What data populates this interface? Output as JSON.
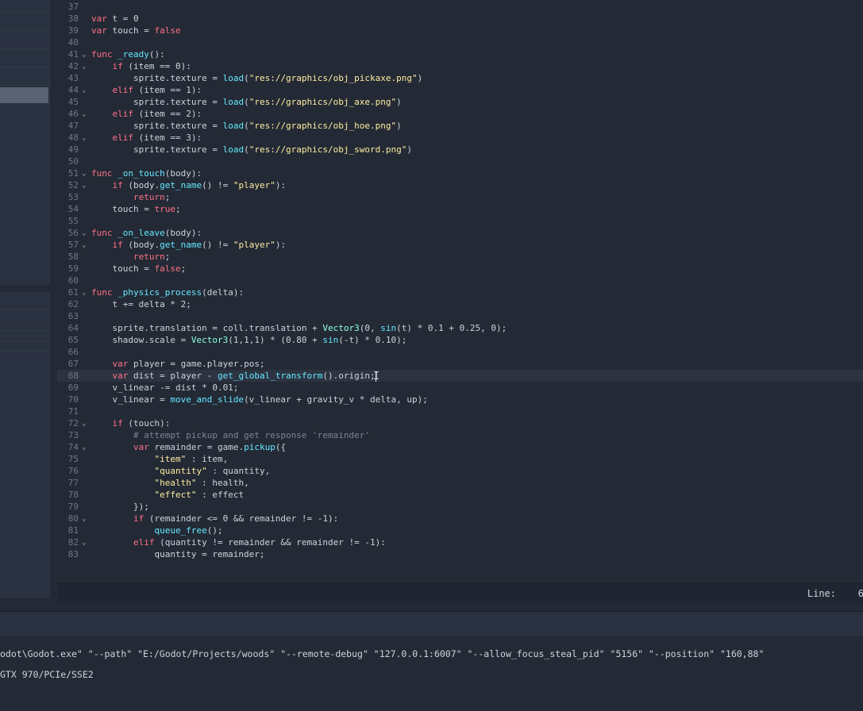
{
  "editor": {
    "lines": [
      {
        "n": "37",
        "fold": "",
        "html": ""
      },
      {
        "n": "38",
        "fold": "",
        "html": "<span class='kw'>var</span> t = 0"
      },
      {
        "n": "39",
        "fold": "",
        "html": "<span class='kw'>var</span> touch = <span class='kw'>false</span>"
      },
      {
        "n": "40",
        "fold": "",
        "html": ""
      },
      {
        "n": "41",
        "fold": "v",
        "html": "<span class='kw'>func</span> <span class='fn'>_ready</span>():"
      },
      {
        "n": "42",
        "fold": "v",
        "html": "    <span class='kw'>if</span> (item == 0):"
      },
      {
        "n": "43",
        "fold": "",
        "html": "        sprite.texture = <span class='fn'>load</span>(<span class='str'>\"res://graphics/obj_pickaxe.png\"</span>)"
      },
      {
        "n": "44",
        "fold": "v",
        "html": "    <span class='kw'>elif</span> (item == 1):"
      },
      {
        "n": "45",
        "fold": "",
        "html": "        sprite.texture = <span class='fn'>load</span>(<span class='str'>\"res://graphics/obj_axe.png\"</span>)"
      },
      {
        "n": "46",
        "fold": "v",
        "html": "    <span class='kw'>elif</span> (item == 2):"
      },
      {
        "n": "47",
        "fold": "",
        "html": "        sprite.texture = <span class='fn'>load</span>(<span class='str'>\"res://graphics/obj_hoe.png\"</span>)"
      },
      {
        "n": "48",
        "fold": "v",
        "html": "    <span class='kw'>elif</span> (item == 3):"
      },
      {
        "n": "49",
        "fold": "",
        "html": "        sprite.texture = <span class='fn'>load</span>(<span class='str'>\"res://graphics/obj_sword.png\"</span>)"
      },
      {
        "n": "50",
        "fold": "",
        "html": ""
      },
      {
        "n": "51",
        "fold": "v",
        "html": "<span class='kw'>func</span> <span class='fn'>_on_touch</span>(body):"
      },
      {
        "n": "52",
        "fold": "v",
        "html": "    <span class='kw'>if</span> (body.<span class='fn'>get_name</span>() != <span class='str'>\"player\"</span>):"
      },
      {
        "n": "53",
        "fold": "",
        "html": "        <span class='kw'>return</span>;"
      },
      {
        "n": "54",
        "fold": "",
        "html": "    touch = <span class='kw'>true</span>;"
      },
      {
        "n": "55",
        "fold": "",
        "html": ""
      },
      {
        "n": "56",
        "fold": "v",
        "html": "<span class='kw'>func</span> <span class='fn'>_on_leave</span>(body):"
      },
      {
        "n": "57",
        "fold": "v",
        "html": "    <span class='kw'>if</span> (body.<span class='fn'>get_name</span>() != <span class='str'>\"player\"</span>):"
      },
      {
        "n": "58",
        "fold": "",
        "html": "        <span class='kw'>return</span>;"
      },
      {
        "n": "59",
        "fold": "",
        "html": "    touch = <span class='kw'>false</span>;"
      },
      {
        "n": "60",
        "fold": "",
        "html": ""
      },
      {
        "n": "61",
        "fold": "v",
        "html": "<span class='kw'>func</span> <span class='fn'>_physics_process</span>(delta):"
      },
      {
        "n": "62",
        "fold": "",
        "html": "    t += delta * 2;"
      },
      {
        "n": "63",
        "fold": "",
        "html": ""
      },
      {
        "n": "64",
        "fold": "",
        "html": "    sprite.translation = coll.translation + <span class='bi'>Vector3</span>(0, <span class='fn'>sin</span>(t) * 0.1 + 0.25, 0);"
      },
      {
        "n": "65",
        "fold": "",
        "html": "    shadow.scale = <span class='bi'>Vector3</span>(1,1,1) * (0.80 + <span class='fn'>sin</span>(-t) * 0.10);"
      },
      {
        "n": "66",
        "fold": "",
        "html": ""
      },
      {
        "n": "67",
        "fold": "",
        "html": "    <span class='kw'>var</span> player = game.player.pos;"
      },
      {
        "n": "68",
        "fold": "",
        "html": "    <span class='kw'>var</span> dist = player - <span class='fn'>get_global_transform</span>().origin;<span class='cursor'></span>"
      },
      {
        "n": "69",
        "fold": "",
        "html": "    v_linear -= dist * 0.01;"
      },
      {
        "n": "70",
        "fold": "",
        "html": "    v_linear = <span class='fn'>move_and_slide</span>(v_linear + gravity_v * delta, up);"
      },
      {
        "n": "71",
        "fold": "",
        "html": ""
      },
      {
        "n": "72",
        "fold": "v",
        "html": "    <span class='kw'>if</span> (touch):"
      },
      {
        "n": "73",
        "fold": "",
        "html": "        <span class='cm'># attempt pickup and get response 'remainder'</span>"
      },
      {
        "n": "74",
        "fold": "v",
        "html": "        <span class='kw'>var</span> remainder = game.<span class='fn'>pickup</span>({"
      },
      {
        "n": "75",
        "fold": "",
        "html": "            <span class='str'>\"item\"</span> : item,"
      },
      {
        "n": "76",
        "fold": "",
        "html": "            <span class='str'>\"quantity\"</span> : quantity,"
      },
      {
        "n": "77",
        "fold": "",
        "html": "            <span class='str'>\"health\"</span> : health,"
      },
      {
        "n": "78",
        "fold": "",
        "html": "            <span class='str'>\"effect\"</span> : effect"
      },
      {
        "n": "79",
        "fold": "",
        "html": "        });"
      },
      {
        "n": "80",
        "fold": "v",
        "html": "        <span class='kw'>if</span> (remainder &lt;= 0 &amp;&amp; remainder != -1):"
      },
      {
        "n": "81",
        "fold": "",
        "html": "            <span class='fn'>queue_free</span>();"
      },
      {
        "n": "82",
        "fold": "v",
        "html": "        <span class='kw'>elif</span> (quantity != remainder &amp;&amp; remainder != -1):"
      },
      {
        "n": "83",
        "fold": "",
        "html": "            quantity = remainder;"
      }
    ],
    "current_line": "68"
  },
  "status": {
    "line_label": "Line:",
    "line_value": "6"
  },
  "output": {
    "lines": [
      "odot\\Godot.exe\" \"--path\" \"E:/Godot/Projects/woods\" \"--remote-debug\" \"127.0.0.1:6007\" \"--allow_focus_steal_pid\" \"5156\" \"--position\" \"160,88\"",
      "GTX 970/PCIe/SSE2"
    ]
  }
}
